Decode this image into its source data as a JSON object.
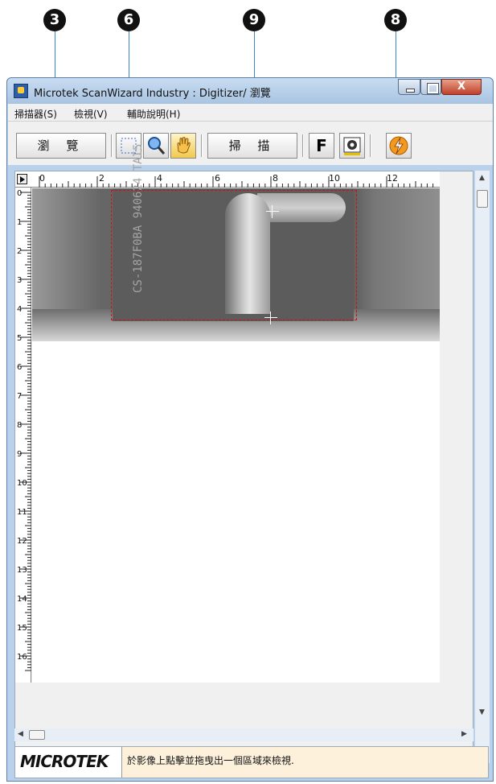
{
  "callouts": [
    "3",
    "6",
    "9",
    "8"
  ],
  "window": {
    "title": "Microtek ScanWizard Industry : Digitizer/ 瀏覽",
    "close_label": "X"
  },
  "menu": {
    "items": [
      "掃描器(S)",
      "檢視(V)",
      "輔助說明(H)"
    ]
  },
  "toolbar": {
    "preview_label": "瀏 覽",
    "scan_label": "掃 描",
    "f_label": "F"
  },
  "ruler": {
    "h_labels": [
      "0",
      "2",
      "4",
      "6",
      "8",
      "10",
      "12"
    ],
    "v_labels": [
      "0",
      "1",
      "2",
      "3",
      "4",
      "5",
      "6",
      "7",
      "8",
      "9",
      "10",
      "11",
      "12",
      "13",
      "14",
      "15",
      "16"
    ]
  },
  "image_text": "CS-187F0BA 940624 TAI5",
  "status": {
    "logo": "MICROTEK",
    "message": "於影像上點擊並拖曳出一個區域來檢視."
  }
}
